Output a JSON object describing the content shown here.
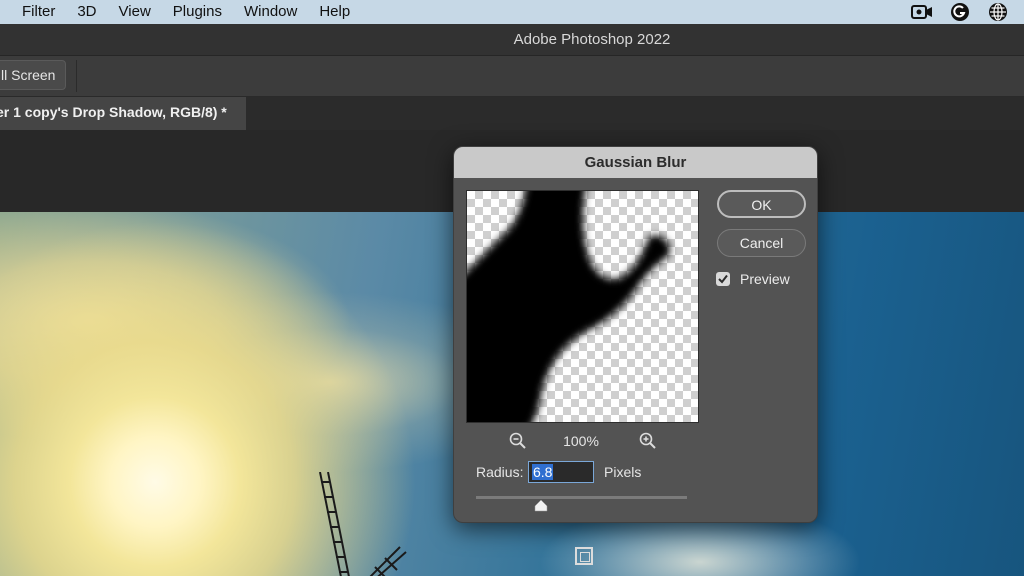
{
  "menubar": {
    "items": [
      "Filter",
      "3D",
      "View",
      "Plugins",
      "Window",
      "Help"
    ],
    "icons": [
      "screen-record-icon",
      "app-g-icon",
      "globe-icon"
    ]
  },
  "window": {
    "title": "Adobe Photoshop 2022"
  },
  "options_bar": {
    "fullscreen_label": "ll Screen"
  },
  "document_tab": {
    "label": "er 1 copy's Drop Shadow, RGB/8) *"
  },
  "dialog": {
    "title": "Gaussian Blur",
    "ok_label": "OK",
    "cancel_label": "Cancel",
    "preview_label": "Preview",
    "preview_checked": true,
    "zoom_value": "100%",
    "radius_label": "Radius:",
    "radius_value": "6.8",
    "radius_unit": "Pixels",
    "slider_fraction": 0.31
  },
  "colors": {
    "selection": "#2f6fd0",
    "dialog_bg": "#535353",
    "title_bar": "#c9c9c9"
  }
}
